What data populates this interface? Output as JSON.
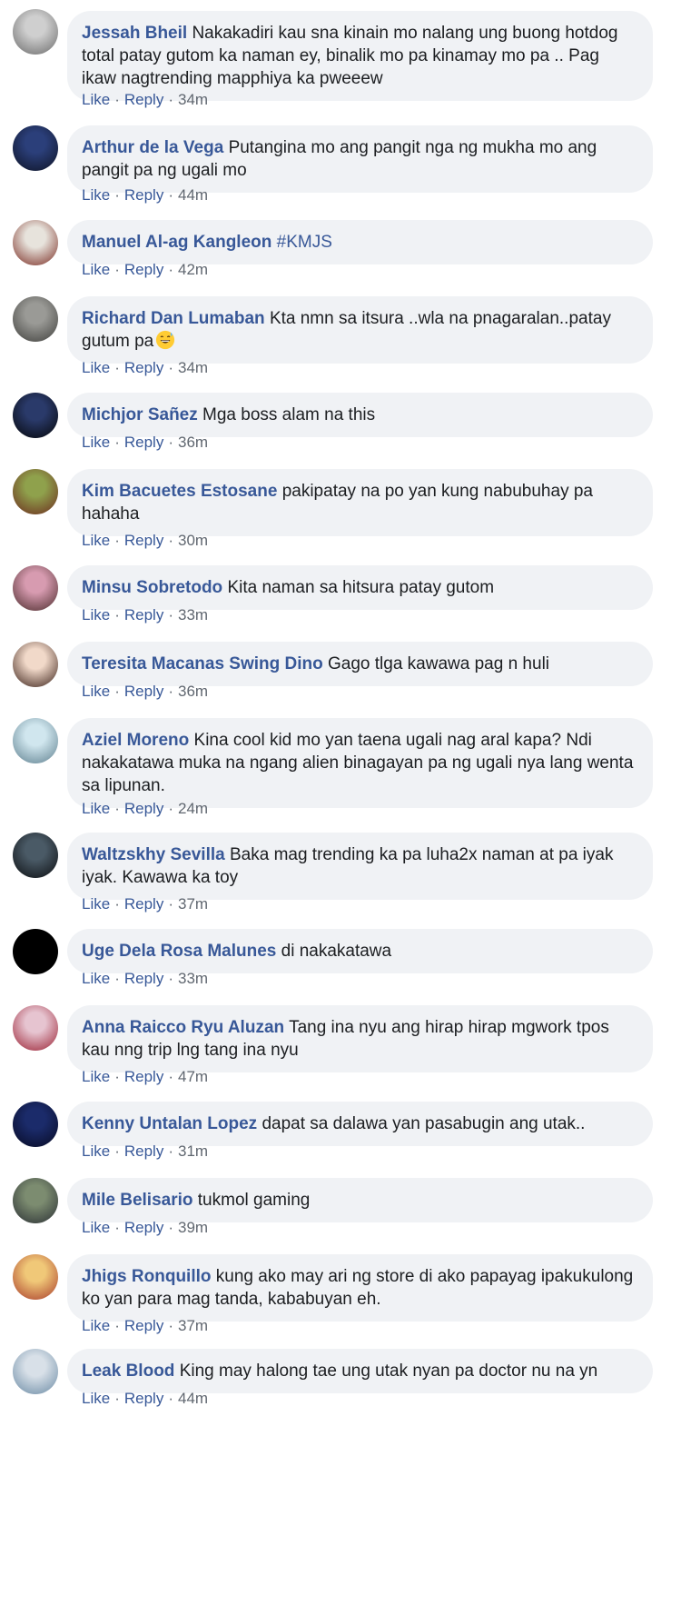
{
  "actions": {
    "like_label": "Like",
    "reply_label": "Reply",
    "separator": "·"
  },
  "comments": [
    {
      "author": "Jessah Bheil",
      "text": "Nakakadiri kau sna kinain mo nalang ung buong hotdog total patay gutom ka naman ey, binalik mo pa kinamay mo pa .. Pag ikaw nagtrending mapphiya ka pweeew",
      "time": "34m",
      "avatar_colors": [
        "#cfcfcf",
        "#6a6a6a"
      ]
    },
    {
      "author": "Arthur de la Vega",
      "text": "Putangina mo ang pangit nga ng mukha mo ang pangit pa ng ugali mo",
      "time": "44m",
      "avatar_colors": [
        "#2b3f7a",
        "#0e1324"
      ]
    },
    {
      "author": "Manuel Al-ag Kangleon",
      "text": "",
      "hashtag": "#KMJS",
      "time": "42m",
      "avatar_colors": [
        "#e7e3dc",
        "#7a2b22"
      ]
    },
    {
      "author": "Richard Dan Lumaban",
      "text": "Kta nmn sa itsura ..wla na pnagaralan..patay gutum pa",
      "emoji": "grinning-sweat-emoji",
      "time": "34m",
      "avatar_colors": [
        "#9a9a96",
        "#3f3f3c"
      ]
    },
    {
      "author": "Michjor Sañez",
      "text": "Mga boss alam na this",
      "time": "36m",
      "avatar_colors": [
        "#2a3a6a",
        "#050608"
      ]
    },
    {
      "author": "Kim Bacuetes Estosane",
      "text": "pakipatay na po yan kung nabubuhay pa hahaha",
      "time": "30m",
      "avatar_colors": [
        "#8fa14c",
        "#6c2a1e"
      ]
    },
    {
      "author": "Minsu Sobretodo",
      "text": "Kita naman sa hitsura patay gutom",
      "time": "33m",
      "avatar_colors": [
        "#d79bb0",
        "#4a2a2a"
      ]
    },
    {
      "author": "Teresita Macanas Swing Dino",
      "text": "Gago tlga kawawa pag n huli",
      "time": "36m",
      "avatar_colors": [
        "#f1d9c9",
        "#3a2018"
      ]
    },
    {
      "author": "Aziel Moreno",
      "text": "Kina cool kid mo yan taena ugali nag aral kapa? Ndi nakakatawa muka na ngang alien binagayan pa ng ugali nya lang wenta sa lipunan.",
      "time": "24m",
      "avatar_colors": [
        "#d0e6ee",
        "#5e7f8e"
      ]
    },
    {
      "author": "Waltzskhy Sevilla",
      "text": "Baka mag trending ka pa luha2x naman at pa iyak iyak. Kawawa ka toy",
      "time": "37m",
      "avatar_colors": [
        "#4a5a66",
        "#0b0d10"
      ]
    },
    {
      "author": "Uge Dela Rosa Malunes",
      "text": "di nakakatawa",
      "time": "33m",
      "avatar_colors": [
        "#000000",
        "#000000"
      ]
    },
    {
      "author": "Anna Raicco Ryu Aluzan",
      "text": "Tang ina nyu ang hirap hirap mgwork tpos kau nng trip lng tang ina nyu",
      "time": "47m",
      "avatar_colors": [
        "#e6c4d0",
        "#9a2032"
      ]
    },
    {
      "author": "Kenny Untalan Lopez",
      "text": "dapat sa dalawa yan pasabugin ang utak..",
      "time": "31m",
      "avatar_colors": [
        "#1b2b6a",
        "#070a22"
      ]
    },
    {
      "author": "Mile Belisario",
      "text": "tukmol gaming",
      "time": "39m",
      "avatar_colors": [
        "#7c8c70",
        "#2a2f34"
      ]
    },
    {
      "author": "Jhigs Ronquillo",
      "text": "kung ako may ari ng store di ako papayag ipakukulong ko yan para mag tanda, kababuyan eh.",
      "time": "37m",
      "avatar_colors": [
        "#f0c878",
        "#a83a2a"
      ]
    },
    {
      "author": "Leak Blood",
      "text": "King may halong tae ung utak nyan pa doctor nu na yn",
      "time": "44m",
      "avatar_colors": [
        "#d8e0e8",
        "#6a8aa4"
      ]
    }
  ]
}
